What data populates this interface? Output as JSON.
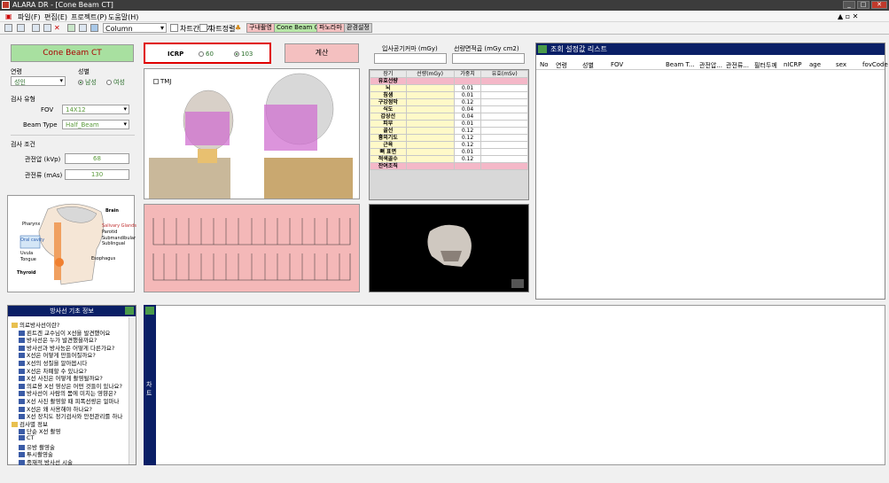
{
  "window": {
    "title": "ALARA DR - [Cone Beam CT]",
    "min": "_",
    "max": "□",
    "close": "✕",
    "mdi_icons": "▲ ▫ ✕"
  },
  "menu": [
    "파일(F)",
    "편집(E)",
    "프로젝트(P)",
    "도움말(H)"
  ],
  "toolbar": {
    "column_combo": "Column",
    "chart_view": "차트간보기",
    "chart_sort": "차트정렬",
    "tags": [
      {
        "label": "구내촬영",
        "color": "#f4c0c0"
      },
      {
        "label": "Cone Beam CT",
        "color": "#b8e8a8"
      },
      {
        "label": "파노라마",
        "color": "#f4c0c0"
      },
      {
        "label": "환경설정",
        "color": "#d0d0d0"
      }
    ]
  },
  "exam_header": "Cone Beam CT",
  "icrp": {
    "label": "ICRP",
    "option_60": "60",
    "option_103": "103",
    "selected": "103"
  },
  "calc_button": "계산",
  "patient": {
    "age_label": "연령",
    "age_value": "성인",
    "sex_label": "성별",
    "male": "남성",
    "female": "여성",
    "sex_selected": "남성"
  },
  "exam_type": {
    "title": "검사 유형",
    "fov_label": "FOV",
    "fov_value": "14X12",
    "beam_label": "Beam Type",
    "beam_value": "Half_Beam"
  },
  "exam_cond": {
    "title": "검사 조건",
    "kvp_label": "관전압 (kVp)",
    "kvp_value": "68",
    "mas_label": "관전류 (mAs)",
    "mas_value": "130"
  },
  "anatomy_labels": [
    "Brain",
    "Pharynx",
    "Salivary Glands",
    "Parotid",
    "Submandibular",
    "Sublingual",
    "Oral cavity",
    "Uvula",
    "Tongue",
    "Esophagus",
    "Thyroid"
  ],
  "tmj_label": "TMJ",
  "dose_headers": {
    "air_kerma": "입사공기커마 (mGy)",
    "dap": "선량면적곱 (mGy cm2)"
  },
  "organ_table": {
    "columns": [
      "장기",
      "선량(mGy)",
      "가중치",
      "유효(mSv)"
    ],
    "rows": [
      {
        "organ": "유효선량",
        "dose": "",
        "weight": "",
        "effective": "",
        "highlight": "pink"
      },
      {
        "organ": "뇌",
        "dose": "",
        "weight": "0.01",
        "effective": "",
        "highlight": ""
      },
      {
        "organ": "침샘",
        "dose": "",
        "weight": "0.01",
        "effective": "",
        "highlight": ""
      },
      {
        "organ": "구강점막",
        "dose": "",
        "weight": "0.12",
        "effective": "",
        "highlight": ""
      },
      {
        "organ": "식도",
        "dose": "",
        "weight": "0.04",
        "effective": "",
        "highlight": ""
      },
      {
        "organ": "갑상선",
        "dose": "",
        "weight": "0.04",
        "effective": "",
        "highlight": ""
      },
      {
        "organ": "피부",
        "dose": "",
        "weight": "0.01",
        "effective": "",
        "highlight": ""
      },
      {
        "organ": "골선",
        "dose": "",
        "weight": "0.12",
        "effective": "",
        "highlight": ""
      },
      {
        "organ": "흉외기도",
        "dose": "",
        "weight": "0.12",
        "effective": "",
        "highlight": ""
      },
      {
        "organ": "근육",
        "dose": "",
        "weight": "0.12",
        "effective": "",
        "highlight": ""
      },
      {
        "organ": "뼈 표면",
        "dose": "",
        "weight": "0.01",
        "effective": "",
        "highlight": ""
      },
      {
        "organ": "적색골수",
        "dose": "",
        "weight": "0.12",
        "effective": "",
        "highlight": ""
      },
      {
        "organ": "잔여조직",
        "dose": "",
        "weight": "",
        "effective": "",
        "highlight": "pink"
      }
    ]
  },
  "list_panel": {
    "title": "조회 설정값 리스트",
    "columns": [
      "No",
      "연령",
      "성별",
      "FOV",
      "Beam T...",
      "관전압...",
      "관전류...",
      "필터두께",
      "nICRP",
      "age",
      "sex",
      "fovCode"
    ]
  },
  "info_tree": {
    "title": "방사선 기초 정보",
    "items": [
      {
        "text": "의료방사선이란?",
        "type": "folder"
      },
      {
        "text": "뢴트겐 교수님이 X선을 발견했어요",
        "type": "doc"
      },
      {
        "text": "방사선은 누가 발견했을까요?",
        "type": "doc"
      },
      {
        "text": "방사선과 방사능은 어떻게 다른가요?",
        "type": "doc"
      },
      {
        "text": "X선은 어떻게 만들어질까요?",
        "type": "doc"
      },
      {
        "text": "X선의 성질을 알아봅시다",
        "type": "doc"
      },
      {
        "text": "X선은 차폐할 수 있나요?",
        "type": "doc"
      },
      {
        "text": "X선 사진은 어떻게 촬영될까요?",
        "type": "doc"
      },
      {
        "text": "의료용 X선 영상은 어떤 것들이 있나요?",
        "type": "doc"
      },
      {
        "text": "방사선이 사람의 몸에 미치는 영향은?",
        "type": "doc"
      },
      {
        "text": "X선 사진 촬영할 때 피폭선량은 얼마나",
        "type": "doc"
      },
      {
        "text": "X선은 왜 사용해야 하나요?",
        "type": "doc"
      },
      {
        "text": "X선 장치도 정기검사와 안전관리를 하나",
        "type": "doc"
      },
      {
        "text": "검사별 정보",
        "type": "folder"
      },
      {
        "text": "단순 X선 촬영",
        "type": "doc"
      },
      {
        "text": "CT",
        "type": "doc"
      },
      {
        "text": "유방 촬영술",
        "type": "doc"
      },
      {
        "text": "투시촬영술",
        "type": "doc"
      },
      {
        "text": "중재적 방사선 시술",
        "type": "doc"
      }
    ]
  },
  "side_strip_label": "차 트"
}
